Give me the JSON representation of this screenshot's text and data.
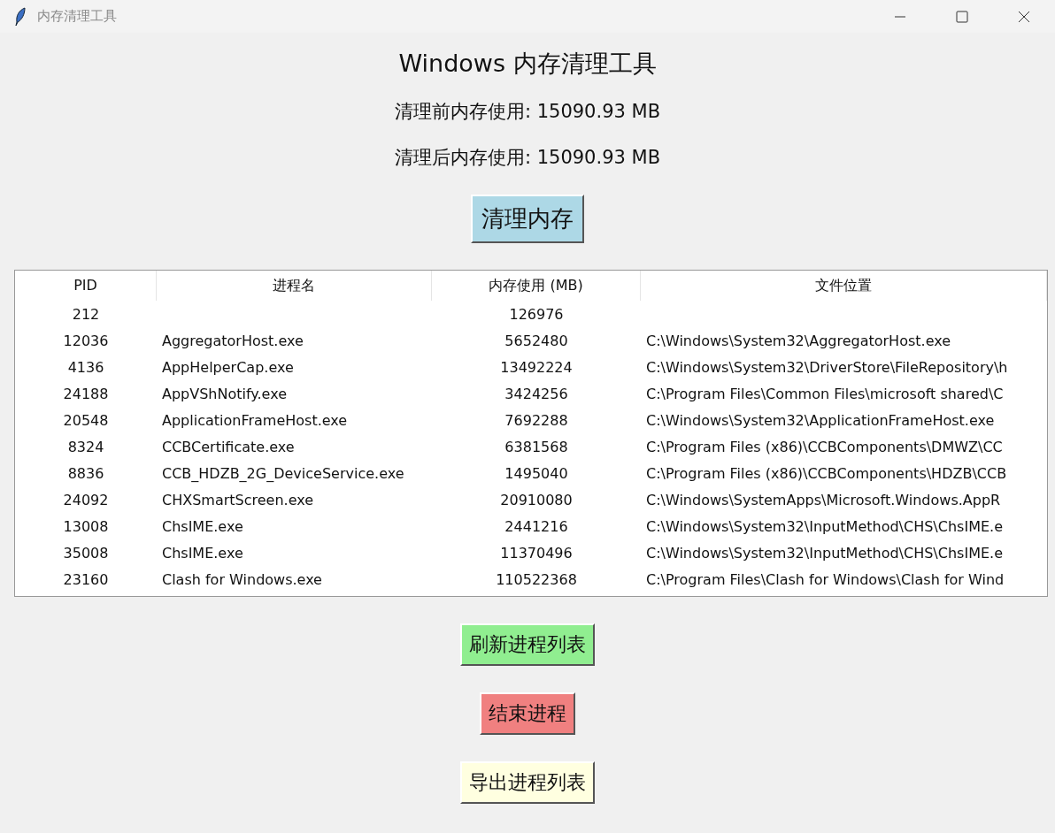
{
  "window": {
    "title": "内存清理工具"
  },
  "heading": "Windows 内存清理工具",
  "before_label": "清理前内存使用: 15090.93 MB",
  "after_label": "清理后内存使用: 15090.93 MB",
  "clean_button": {
    "label": "清理内存",
    "color": "#add8e6"
  },
  "table": {
    "columns": [
      "PID",
      "进程名",
      "内存使用 (MB)",
      "文件位置"
    ],
    "rows": [
      [
        "212",
        "",
        "126976",
        ""
      ],
      [
        "12036",
        "AggregatorHost.exe",
        "5652480",
        "C:\\Windows\\System32\\AggregatorHost.exe"
      ],
      [
        "4136",
        "AppHelperCap.exe",
        "13492224",
        "C:\\Windows\\System32\\DriverStore\\FileRepository\\h"
      ],
      [
        "24188",
        "AppVShNotify.exe",
        "3424256",
        "C:\\Program Files\\Common Files\\microsoft shared\\C"
      ],
      [
        "20548",
        "ApplicationFrameHost.exe",
        "7692288",
        "C:\\Windows\\System32\\ApplicationFrameHost.exe"
      ],
      [
        "8324",
        "CCBCertificate.exe",
        "6381568",
        "C:\\Program Files (x86)\\CCBComponents\\DMWZ\\CC"
      ],
      [
        "8836",
        "CCB_HDZB_2G_DeviceService.exe",
        "1495040",
        "C:\\Program Files (x86)\\CCBComponents\\HDZB\\CCB"
      ],
      [
        "24092",
        "CHXSmartScreen.exe",
        "20910080",
        "C:\\Windows\\SystemApps\\Microsoft.Windows.AppR"
      ],
      [
        "13008",
        "ChsIME.exe",
        "2441216",
        "C:\\Windows\\System32\\InputMethod\\CHS\\ChsIME.e"
      ],
      [
        "35008",
        "ChsIME.exe",
        "11370496",
        "C:\\Windows\\System32\\InputMethod\\CHS\\ChsIME.e"
      ],
      [
        "23160",
        "Clash for Windows.exe",
        "110522368",
        "C:\\Program Files\\Clash for Windows\\Clash for Wind"
      ]
    ]
  },
  "actions": [
    {
      "label": "刷新进程列表",
      "color": "#90ee90"
    },
    {
      "label": "结束进程",
      "color": "#f08080"
    },
    {
      "label": "导出进程列表",
      "color": "#ffffe0"
    }
  ]
}
